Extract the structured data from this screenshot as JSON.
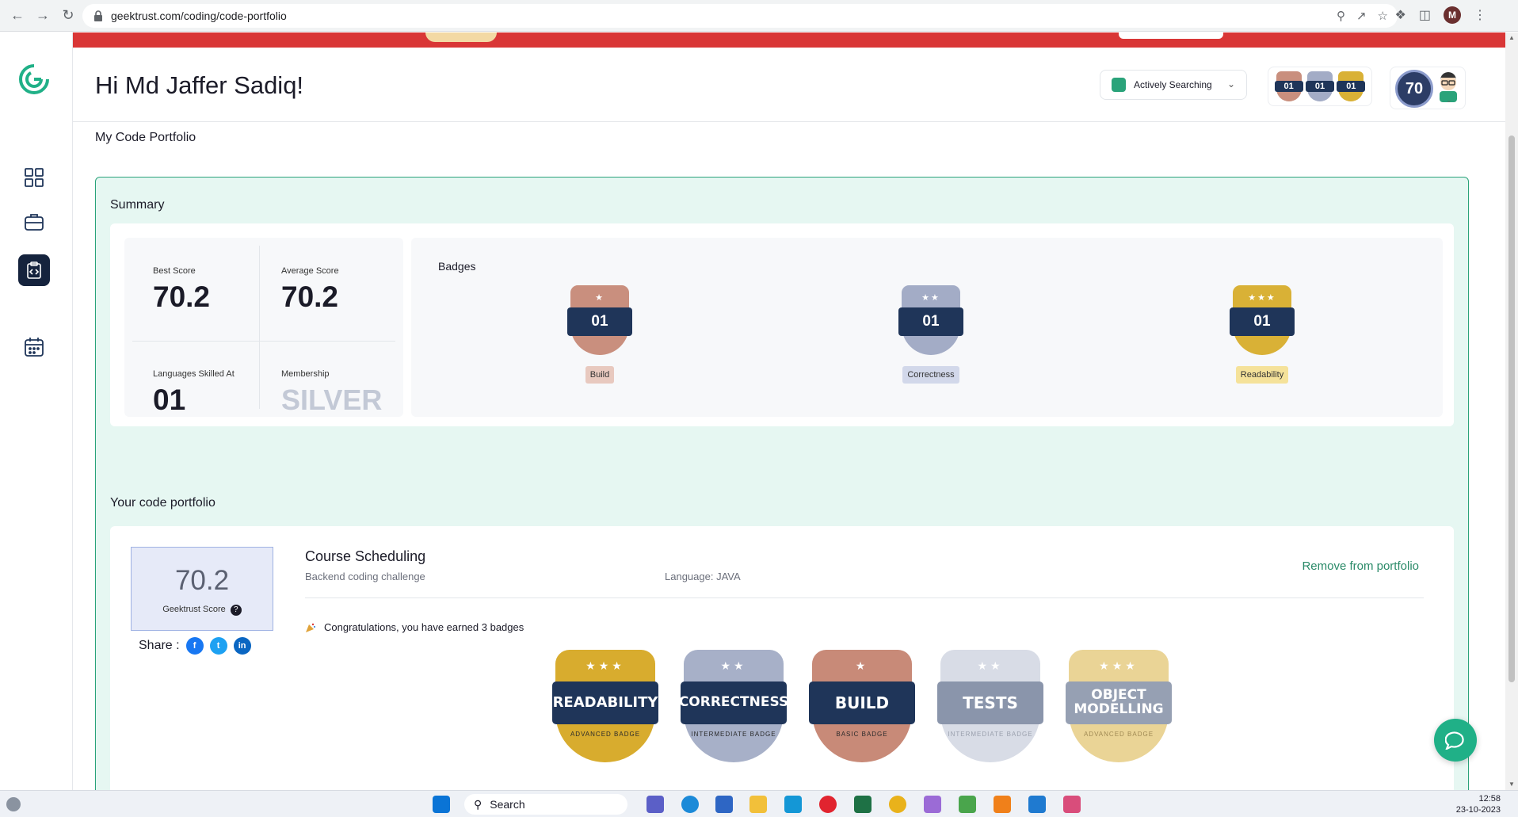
{
  "browser": {
    "url": "geektrust.com/coding/code-portfolio",
    "profile_initial": "M"
  },
  "header": {
    "greeting": "Hi Md Jaffer Sadiq!",
    "status_label": "Actively Searching",
    "mini_badges": [
      "01",
      "01",
      "01"
    ],
    "score": "70"
  },
  "page": {
    "title": "My Code Portfolio"
  },
  "summary": {
    "title": "Summary",
    "best_score_label": "Best Score",
    "best_score": "70.2",
    "average_score_label": "Average Score",
    "average_score": "70.2",
    "languages_label": "Languages Skilled At",
    "languages": "01",
    "membership_label": "Membership",
    "membership": "SILVER",
    "badges_title": "Badges",
    "badges": [
      {
        "count": "01",
        "label": "Build",
        "color": "#c98f7e",
        "chip": "#e8c9bf"
      },
      {
        "count": "01",
        "label": "Correctness",
        "color": "#a3acc6",
        "chip": "#d2d8ea"
      },
      {
        "count": "01",
        "label": "Readability",
        "color": "#d9b136",
        "chip": "#f5e29a"
      }
    ]
  },
  "portfolio": {
    "title": "Your code portfolio",
    "project": {
      "score": "70.2",
      "score_caption": "Geektrust Score",
      "name": "Course Scheduling",
      "type": "Backend coding challenge",
      "language": "Language: JAVA",
      "remove_label": "Remove from portfolio",
      "share_label": "Share :",
      "congrats": "Congratulations, you have earned 3 badges",
      "badges": [
        {
          "name": "READABILITY",
          "level": "ADVANCED BADGE",
          "stars": "★★★",
          "color": "#d8ac2e"
        },
        {
          "name": "CORRECTNESS",
          "level": "INTERMEDIATE BADGE",
          "stars": "★★",
          "color": "#a7b0c8"
        },
        {
          "name": "BUILD",
          "level": "BASIC BADGE",
          "stars": "★",
          "color": "#c88a78"
        },
        {
          "name": "TESTS",
          "level": "INTERMEDIATE BADGE",
          "stars": "★★",
          "color": "#d8dce6"
        },
        {
          "name": "OBJECT MODELLING",
          "level": "ADVANCED BADGE",
          "stars": "★★★",
          "color": "#ead496"
        }
      ]
    }
  },
  "taskbar": {
    "search_label": "Search",
    "time": "12:58",
    "date": "23-10-2023"
  }
}
